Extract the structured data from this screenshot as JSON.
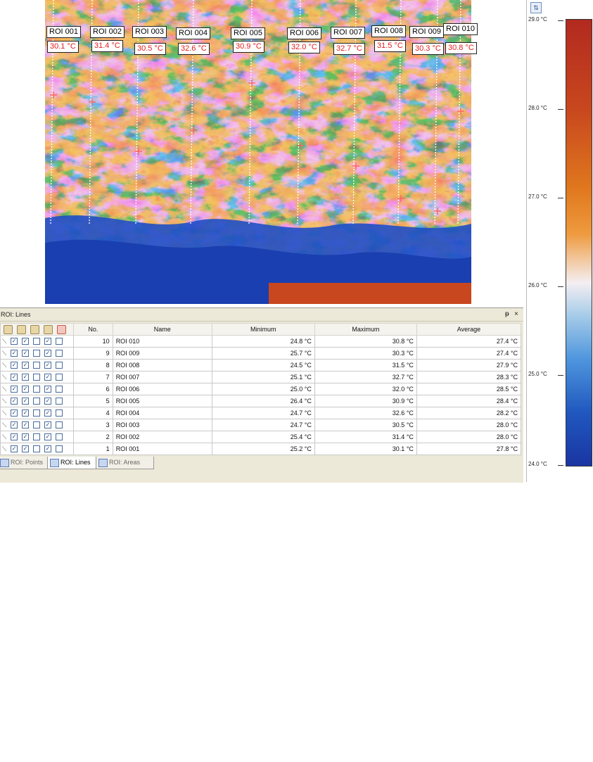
{
  "thermal_overlay": {
    "rois": [
      {
        "label": "ROI 001",
        "temp": "30.1 °C"
      },
      {
        "label": "ROI 002",
        "temp": "31.4 °C"
      },
      {
        "label": "ROI 003",
        "temp": "30.5 °C"
      },
      {
        "label": "ROI 004",
        "temp": "32.6 °C"
      },
      {
        "label": "ROI 005",
        "temp": "30.9 °C"
      },
      {
        "label": "ROI 006",
        "temp": "32.0 °C"
      },
      {
        "label": "ROI 007",
        "temp": "32.7 °C"
      },
      {
        "label": "ROI 008",
        "temp": "31.5 °C"
      },
      {
        "label": "ROI 009",
        "temp": "30.3 °C"
      },
      {
        "label": "ROI 010",
        "temp": "30.8 °C"
      }
    ]
  },
  "scale": {
    "ticks": [
      "29.0 °C",
      "28.0 °C",
      "27.0 °C",
      "26.0 °C",
      "25.0 °C",
      "24.0 °C"
    ],
    "colors": [
      "#b22a1f",
      "#e0781e",
      "#f4eef2",
      "#4f96dd",
      "#1a35a2"
    ]
  },
  "roi_panel": {
    "title": "ROI: Lines",
    "pin_icon": "pin-icon",
    "close_label": "×",
    "columns": [
      "No.",
      "Name",
      "Minimum",
      "Maximum",
      "Average"
    ],
    "rows": [
      {
        "no": "10",
        "name": "ROI 010",
        "min": "24.8 °C",
        "max": "30.8 °C",
        "avg": "27.4 °C"
      },
      {
        "no": "9",
        "name": "ROI 009",
        "min": "25.7 °C",
        "max": "30.3 °C",
        "avg": "27.4 °C"
      },
      {
        "no": "8",
        "name": "ROI 008",
        "min": "24.5 °C",
        "max": "31.5 °C",
        "avg": "27.9 °C"
      },
      {
        "no": "7",
        "name": "ROI 007",
        "min": "25.1 °C",
        "max": "32.7 °C",
        "avg": "28.3 °C"
      },
      {
        "no": "6",
        "name": "ROI 006",
        "min": "25.0 °C",
        "max": "32.0 °C",
        "avg": "28.5 °C"
      },
      {
        "no": "5",
        "name": "ROI 005",
        "min": "26.4 °C",
        "max": "30.9 °C",
        "avg": "28.4 °C"
      },
      {
        "no": "4",
        "name": "ROI 004",
        "min": "24.7 °C",
        "max": "32.6 °C",
        "avg": "28.2 °C"
      },
      {
        "no": "3",
        "name": "ROI 003",
        "min": "24.7 °C",
        "max": "30.5 °C",
        "avg": "28.0 °C"
      },
      {
        "no": "2",
        "name": "ROI 002",
        "min": "25.4 °C",
        "max": "31.4 °C",
        "avg": "28.0 °C"
      },
      {
        "no": "1",
        "name": "ROI 001",
        "min": "25.2 °C",
        "max": "30.1 °C",
        "avg": "27.8 °C"
      }
    ],
    "tabs": [
      {
        "label": "ROI: Points",
        "active": false
      },
      {
        "label": "ROI: Lines",
        "active": true
      },
      {
        "label": "ROI: Areas",
        "active": false
      }
    ]
  }
}
